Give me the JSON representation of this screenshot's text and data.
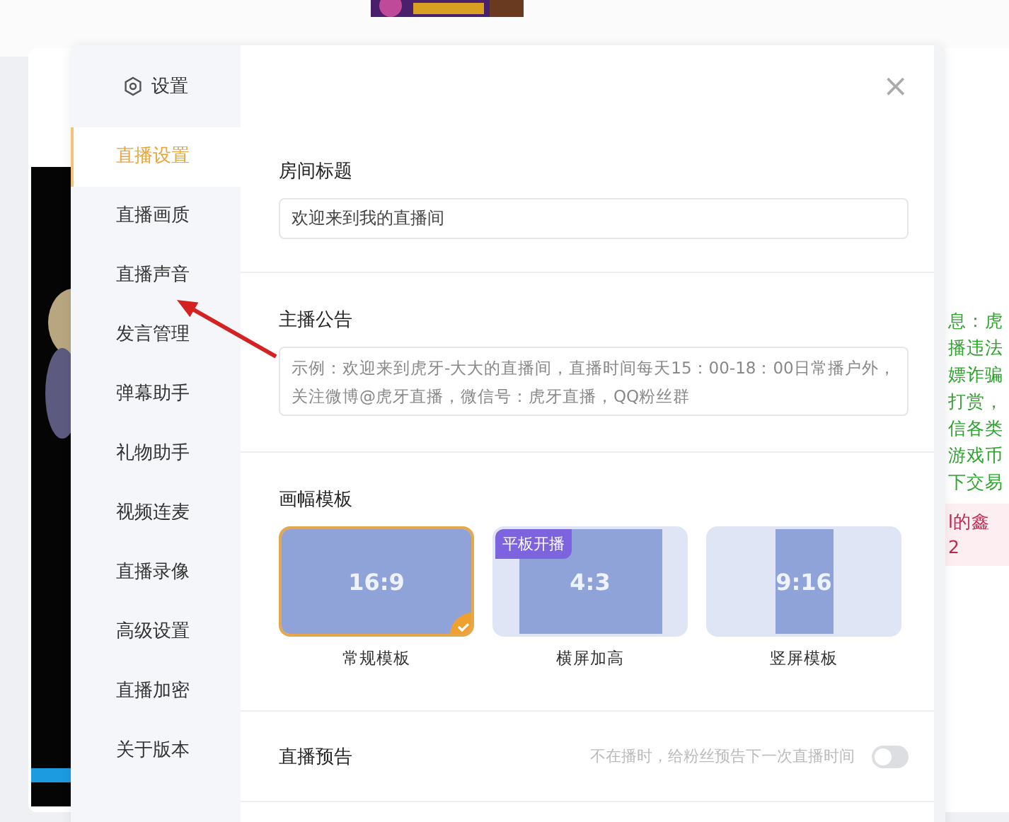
{
  "dialog": {
    "title": "设置",
    "close": "×"
  },
  "sidebar": {
    "items": [
      {
        "label": "直播设置",
        "selected": true
      },
      {
        "label": "直播画质",
        "selected": false
      },
      {
        "label": "直播声音",
        "selected": false
      },
      {
        "label": "发言管理",
        "selected": false
      },
      {
        "label": "弹幕助手",
        "selected": false
      },
      {
        "label": "礼物助手",
        "selected": false
      },
      {
        "label": "视频连麦",
        "selected": false
      },
      {
        "label": "直播录像",
        "selected": false
      },
      {
        "label": "高级设置",
        "selected": false
      },
      {
        "label": "直播加密",
        "selected": false
      },
      {
        "label": "关于版本",
        "selected": false
      }
    ]
  },
  "room_title": {
    "label": "房间标题",
    "value": "欢迎来到我的直播间"
  },
  "announcement": {
    "label": "主播公告",
    "placeholder": "示例：欢迎来到虎牙-大大的直播间，直播时间每天15：00-18：00日常播户外，关注微博@虎牙直播，微信号：虎牙直播，QQ粉丝群"
  },
  "templates": {
    "label": "画幅模板",
    "items": [
      {
        "kind": "full",
        "ratio": "16:9",
        "name": "常规模板",
        "selected": true
      },
      {
        "kind": "wide",
        "ratio": "4:3",
        "name": "横屏加高",
        "selected": false,
        "badge": "平板开播"
      },
      {
        "kind": "portrait",
        "ratio": "9:16",
        "name": "竖屏模板",
        "selected": false
      }
    ]
  },
  "preview": {
    "label": "直播预告",
    "hint": "不在播时，给粉丝预告下一次直播时间",
    "on": false
  },
  "background": {
    "notice_lines": [
      "息：虎",
      "播违法",
      "嫖诈骗",
      "打赏，",
      "信各类",
      "游戏币",
      "下交易"
    ],
    "warning_lines": [
      "l的鑫",
      "2"
    ]
  }
}
